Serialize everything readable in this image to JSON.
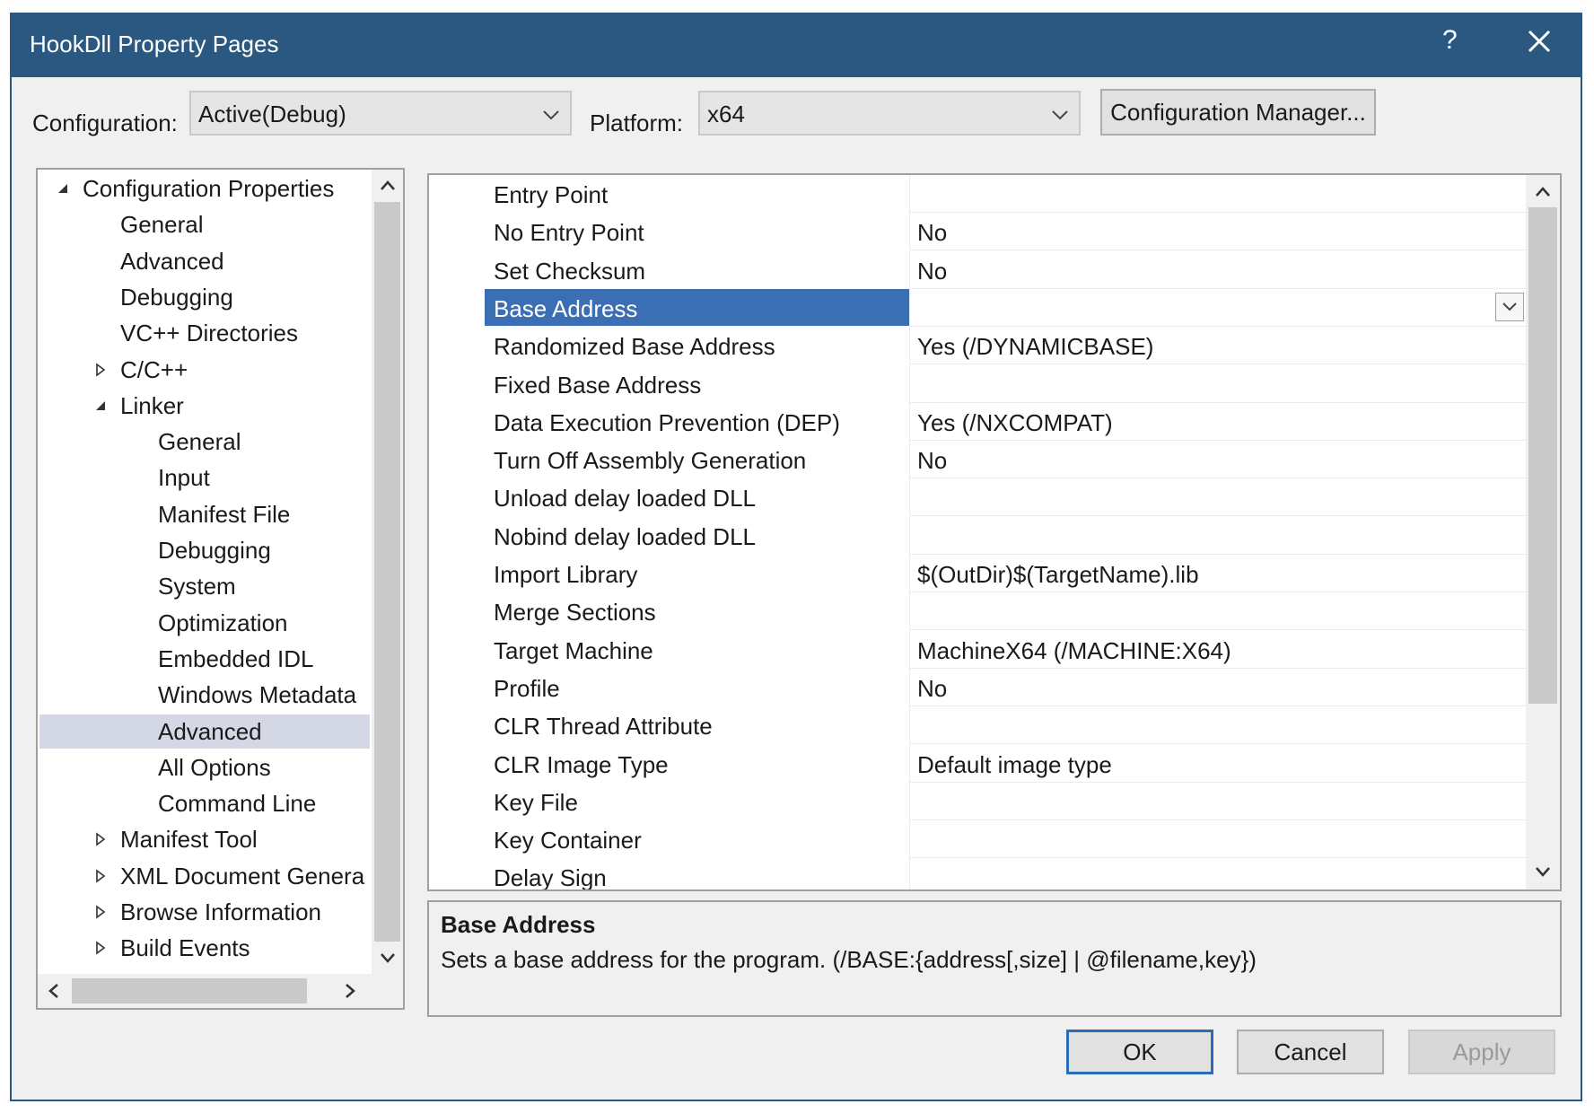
{
  "window": {
    "title": "HookDll Property Pages",
    "help": "?"
  },
  "config": {
    "configuration_label": "Configuration:",
    "configuration_value": "Active(Debug)",
    "platform_label": "Platform:",
    "platform_value": "x64",
    "manager_button": "Configuration Manager..."
  },
  "tree": {
    "items": [
      {
        "label": "Configuration Properties",
        "level": 0,
        "expander": "expanded",
        "selected": false
      },
      {
        "label": "General",
        "level": 1,
        "expander": "none",
        "selected": false
      },
      {
        "label": "Advanced",
        "level": 1,
        "expander": "none",
        "selected": false
      },
      {
        "label": "Debugging",
        "level": 1,
        "expander": "none",
        "selected": false
      },
      {
        "label": "VC++ Directories",
        "level": 1,
        "expander": "none",
        "selected": false
      },
      {
        "label": "C/C++",
        "level": 1,
        "expander": "collapsed",
        "selected": false
      },
      {
        "label": "Linker",
        "level": 1,
        "expander": "expanded",
        "selected": false
      },
      {
        "label": "General",
        "level": 2,
        "expander": "none",
        "selected": false
      },
      {
        "label": "Input",
        "level": 2,
        "expander": "none",
        "selected": false
      },
      {
        "label": "Manifest File",
        "level": 2,
        "expander": "none",
        "selected": false
      },
      {
        "label": "Debugging",
        "level": 2,
        "expander": "none",
        "selected": false
      },
      {
        "label": "System",
        "level": 2,
        "expander": "none",
        "selected": false
      },
      {
        "label": "Optimization",
        "level": 2,
        "expander": "none",
        "selected": false
      },
      {
        "label": "Embedded IDL",
        "level": 2,
        "expander": "none",
        "selected": false
      },
      {
        "label": "Windows Metadata",
        "level": 2,
        "expander": "none",
        "selected": false
      },
      {
        "label": "Advanced",
        "level": 2,
        "expander": "none",
        "selected": true
      },
      {
        "label": "All Options",
        "level": 2,
        "expander": "none",
        "selected": false
      },
      {
        "label": "Command Line",
        "level": 2,
        "expander": "none",
        "selected": false
      },
      {
        "label": "Manifest Tool",
        "level": 1,
        "expander": "collapsed",
        "selected": false
      },
      {
        "label": "XML Document Genera",
        "level": 1,
        "expander": "collapsed",
        "selected": false
      },
      {
        "label": "Browse Information",
        "level": 1,
        "expander": "collapsed",
        "selected": false
      },
      {
        "label": "Build Events",
        "level": 1,
        "expander": "collapsed",
        "selected": false
      }
    ]
  },
  "properties": [
    {
      "name": "Entry Point",
      "value": ""
    },
    {
      "name": "No Entry Point",
      "value": "No"
    },
    {
      "name": "Set Checksum",
      "value": "No"
    },
    {
      "name": "Base Address",
      "value": "",
      "selected": true
    },
    {
      "name": "Randomized Base Address",
      "value": "Yes (/DYNAMICBASE)"
    },
    {
      "name": "Fixed Base Address",
      "value": ""
    },
    {
      "name": "Data Execution Prevention (DEP)",
      "value": "Yes (/NXCOMPAT)"
    },
    {
      "name": "Turn Off Assembly Generation",
      "value": "No"
    },
    {
      "name": "Unload delay loaded DLL",
      "value": ""
    },
    {
      "name": "Nobind delay loaded DLL",
      "value": ""
    },
    {
      "name": "Import Library",
      "value": "$(OutDir)$(TargetName).lib"
    },
    {
      "name": "Merge Sections",
      "value": ""
    },
    {
      "name": "Target Machine",
      "value": "MachineX64 (/MACHINE:X64)"
    },
    {
      "name": "Profile",
      "value": "No"
    },
    {
      "name": "CLR Thread Attribute",
      "value": ""
    },
    {
      "name": "CLR Image Type",
      "value": "Default image type"
    },
    {
      "name": "Key File",
      "value": ""
    },
    {
      "name": "Key Container",
      "value": ""
    },
    {
      "name": "Delay Sign",
      "value": ""
    }
  ],
  "description": {
    "title": "Base Address",
    "text": "Sets a base address for the program. (/BASE:{address[,size] | @filename,key})"
  },
  "buttons": {
    "ok": "OK",
    "cancel": "Cancel",
    "apply": "Apply"
  },
  "colors": {
    "titlebar": "#2b5880",
    "selection": "#3c6eb4",
    "tree_selection": "#d4d8e4"
  }
}
